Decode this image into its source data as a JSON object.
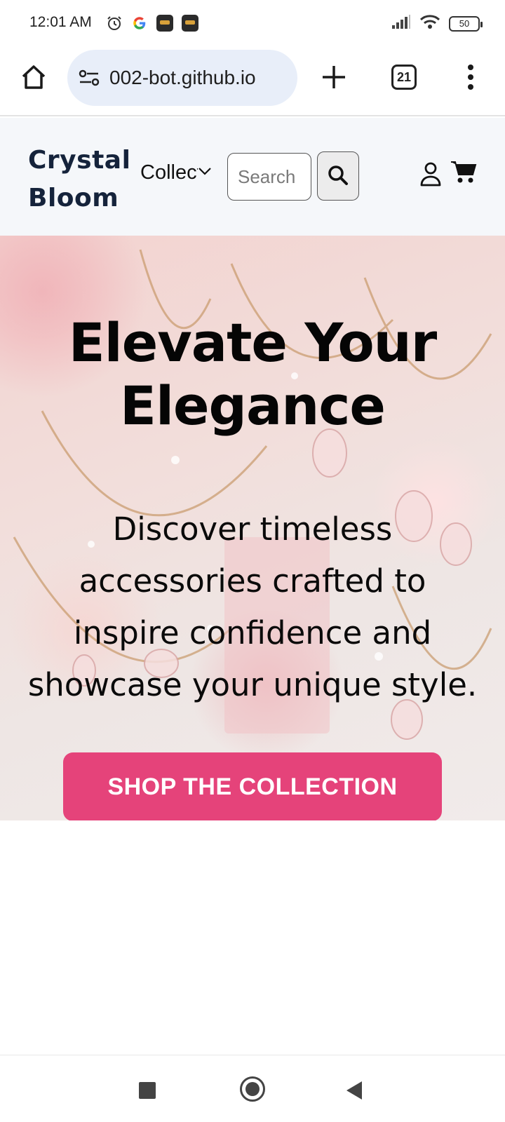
{
  "status_bar": {
    "time": "12:01 AM",
    "battery": "50",
    "icons": [
      "alarm-icon",
      "google-icon",
      "app-icon",
      "app-icon",
      "signal-icon",
      "wifi-icon",
      "battery-icon"
    ]
  },
  "browser": {
    "url": "002-bot.github.io",
    "tab_count": "21",
    "icons": [
      "home-icon",
      "tune-icon",
      "plus-icon",
      "tabs-icon",
      "more-vert-icon"
    ]
  },
  "site": {
    "brand_line1": "Crystal",
    "brand_line2": "Bloom",
    "collections_label": "Collections",
    "search_placeholder": "Search",
    "icons": [
      "chevron-down-icon",
      "search-icon",
      "user-icon",
      "cart-icon"
    ]
  },
  "hero": {
    "title_line1": "Elevate Your",
    "title_line2": "Elegance",
    "subtitle_lines": [
      "Discover timeless",
      "accessories crafted to",
      "inspire confidence and",
      "showcase your unique style."
    ],
    "cta_label": "SHOP THE COLLECTION",
    "cta_color": "#e5437a"
  },
  "nav_bar": {
    "icons": [
      "recents-icon",
      "home-circle-icon",
      "back-icon"
    ]
  }
}
